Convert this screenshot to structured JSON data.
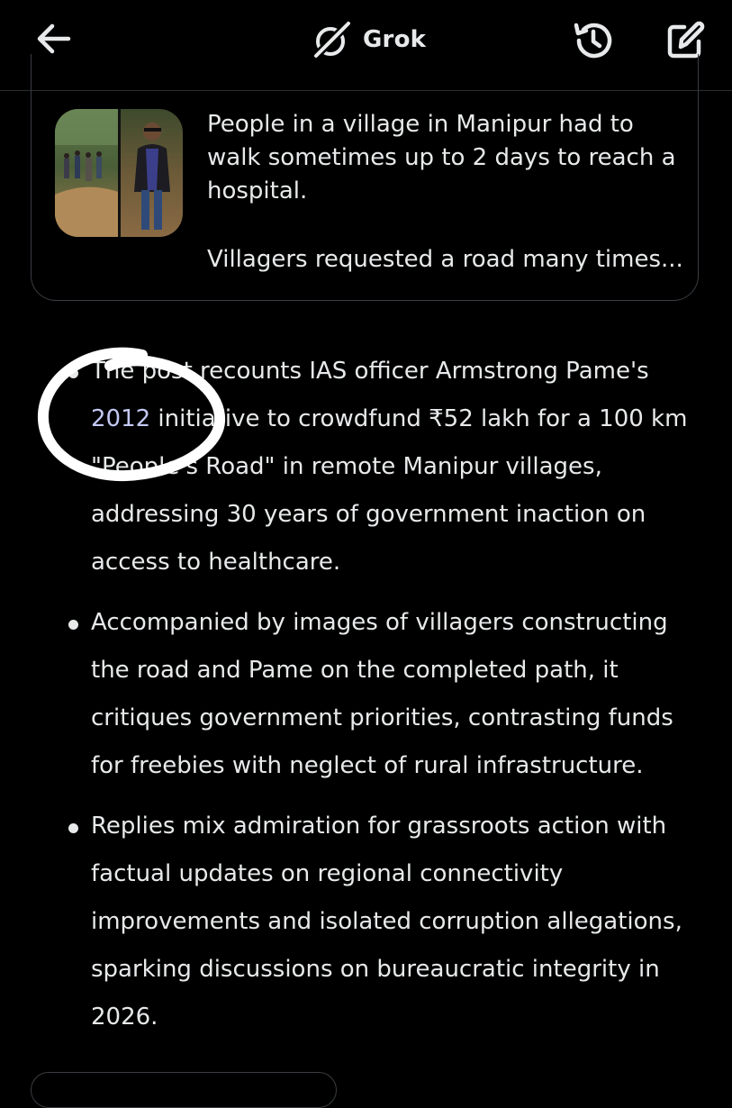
{
  "app": {
    "brand_name": "Grok"
  },
  "header": {
    "back_icon": "arrow-left-icon",
    "logo_icon": "grok-logo-icon",
    "history_icon": "history-icon",
    "compose_icon": "compose-icon"
  },
  "source_card": {
    "line1": "People in a village in Manipur had to walk sometimes up to 2 days to reach a hospital.",
    "line2": "Villagers requested a road many times..."
  },
  "bullets": [
    {
      "pre": "The post recounts IAS officer Armstrong Pame's ",
      "highlight": "2012",
      "post": " initiative to crowdfund ₹52 lakh for a 100 km \"People's Road\" in remote Manipur villages, addressing 30 years of government inaction on access to healthcare."
    },
    {
      "text": "Accompanied by images of villagers constructing the road and Pame on the completed path, it critiques government priorities, contrasting funds for freebies with neglect of rural infrastructure."
    },
    {
      "text": "Replies mix admiration for grassroots action with factual updates on regional connectivity improvements and isolated corruption allegations, sparking discussions on bureaucratic integrity in 2026."
    }
  ],
  "colors": {
    "background": "#000000",
    "text": "#e7e9ea",
    "link_highlight": "#c3c8f2",
    "border": "#3a3d42",
    "annotation": "#ffffff"
  }
}
